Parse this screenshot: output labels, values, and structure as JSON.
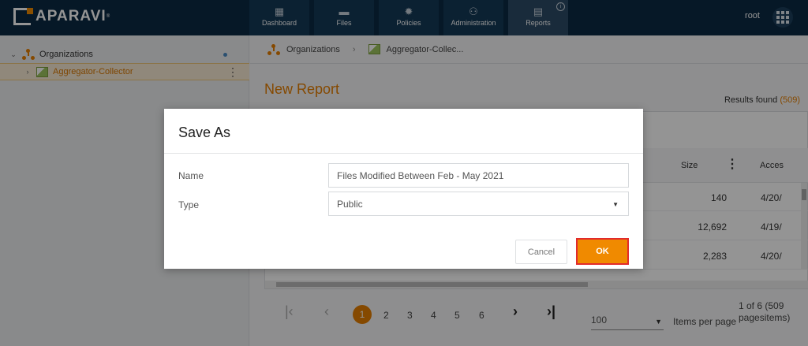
{
  "app": {
    "logo_text": "APARAVI",
    "logo_sup": "®"
  },
  "nav": {
    "tabs": [
      {
        "label": "Dashboard",
        "icon": "dashboard-icon"
      },
      {
        "label": "Files",
        "icon": "folder-icon"
      },
      {
        "label": "Policies",
        "icon": "gear-icon"
      },
      {
        "label": "Administration",
        "icon": "users-icon"
      },
      {
        "label": "Reports",
        "icon": "clipboard-icon",
        "active": true
      }
    ],
    "info_badge": "i",
    "user": "root"
  },
  "sidebar": {
    "root": {
      "label": "Organizations"
    },
    "child": {
      "label": "Aggregator-Collector",
      "selected": true
    }
  },
  "main": {
    "breadcrumb": [
      "Organizations",
      "Aggregator-Collec..."
    ],
    "report_title": "New Report",
    "results_label": "Results found",
    "results_count": "(509)",
    "columns": {
      "size": "Size",
      "accessed": "Acces"
    },
    "rows": [
      {
        "size": "140",
        "accessed": "4/20/"
      },
      {
        "size": "12,692",
        "accessed": "4/19/"
      },
      {
        "size": "2,283",
        "accessed": "4/20/"
      }
    ],
    "pager": {
      "pages": [
        "1",
        "2",
        "3",
        "4",
        "5",
        "6"
      ],
      "current": "1",
      "per_page_value": "100",
      "per_page_label": "Items per page",
      "info_line1": "1 of 6 (509",
      "info_line2": "pagesitems)"
    }
  },
  "dialog": {
    "title": "Save As",
    "name_label": "Name",
    "name_value": "Files Modified Between Feb - May 2021",
    "type_label": "Type",
    "type_value": "Public",
    "cancel_label": "Cancel",
    "ok_label": "OK"
  },
  "colors": {
    "accent": "#f08a00",
    "header": "#0b2a44",
    "ok_outline": "#e22b2b"
  }
}
